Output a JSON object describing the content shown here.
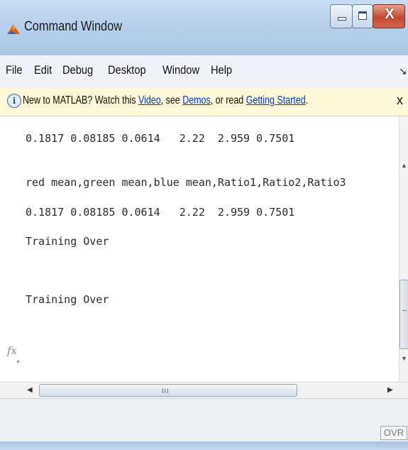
{
  "window": {
    "title": "Command Window",
    "close_glyph": "X",
    "title_bar_color": "#b7cfea",
    "close_button_color": "#c44a33"
  },
  "menu": {
    "items": [
      "File",
      "Edit",
      "Debug",
      "Desktop",
      "Window",
      "Help"
    ],
    "undock_arrow_glyph": "↘"
  },
  "infobar": {
    "icon_glyph": "i",
    "text_1": "New to MATLAB? Watch this ",
    "link_video": "Video",
    "text_2": ", see ",
    "link_demos": "Demos",
    "text_3": ", or read ",
    "link_getting_started": "Getting Started",
    "text_4": ".",
    "close_glyph": "x",
    "background_color": "#fcf8d8",
    "link_color": "#0033cc"
  },
  "console": {
    "lines": [
      "0.1817 0.08185 0.0614   2.22  2.959 0.7501",
      "red mean,green mean,blue mean,Ratio1,Ratio2,Ratio3",
      "0.1817 0.08185 0.0614   2.22  2.959 0.7501",
      "Training Over",
      "",
      "Training Over"
    ],
    "prompt_icon": "fx"
  },
  "scrollbars": {
    "vertical": {
      "up_glyph": "▲",
      "down_glyph": "▼",
      "grip_glyph": "≡"
    },
    "horizontal": {
      "left_glyph": "◀",
      "right_glyph": "▶",
      "grip_glyph": "III"
    }
  },
  "status": {
    "overwrite_indicator": "OVR"
  }
}
